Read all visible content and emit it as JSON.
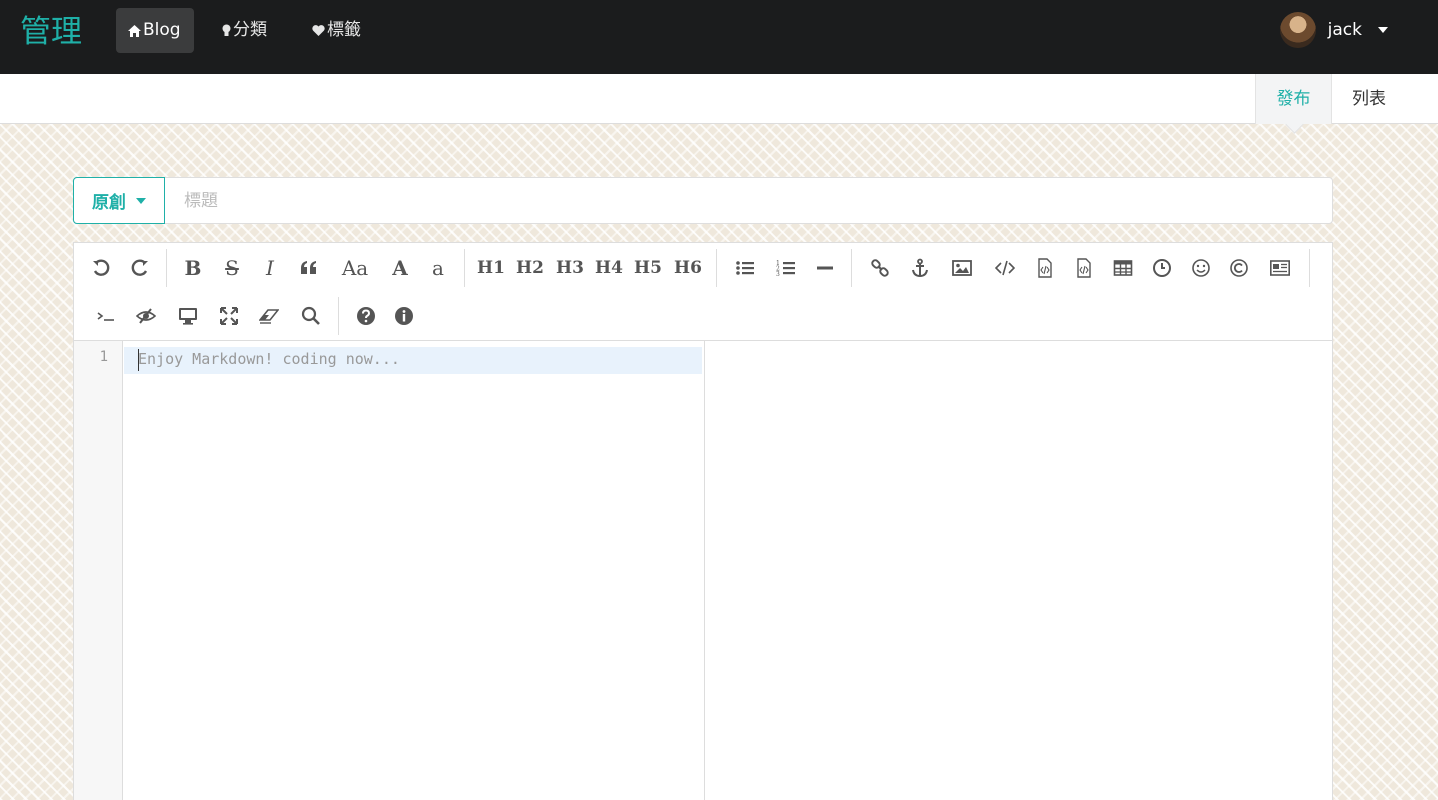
{
  "nav": {
    "brand": "管理",
    "items": [
      {
        "label": "Blog",
        "icon": "home-icon",
        "active": true
      },
      {
        "label": "分類",
        "icon": "lightbulb-icon",
        "active": false
      },
      {
        "label": "標籤",
        "icon": "heart-icon",
        "active": false
      }
    ],
    "user": {
      "name": "jack"
    }
  },
  "subnav": {
    "tabs": [
      {
        "label": "發布",
        "active": true
      },
      {
        "label": "列表",
        "active": false
      }
    ]
  },
  "post": {
    "type_label": "原創",
    "title_placeholder": "標題"
  },
  "toolbar": {
    "row1": [
      "undo",
      "redo",
      "bold",
      "strikethrough",
      "italic",
      "quote",
      "uppercase",
      "A",
      "lowercase",
      "H1",
      "H2",
      "H3",
      "H4",
      "H5",
      "H6",
      "unordered-list",
      "ordered-list",
      "hr",
      "link",
      "anchor",
      "image",
      "code",
      "code-block",
      "preformatted",
      "table",
      "datetime",
      "emoji",
      "html-entities",
      "pagebreak"
    ],
    "row2": [
      "terminal",
      "watch",
      "preview",
      "fullscreen",
      "clear",
      "search",
      "help",
      "info"
    ],
    "heading_labels": [
      "H1",
      "H2",
      "H3",
      "H4",
      "H5",
      "H6"
    ],
    "text_glyphs": {
      "bold": "B",
      "strikethrough": "S",
      "italic": "I",
      "uppercase": "Aa",
      "A": "A",
      "lowercase": "a"
    }
  },
  "editor": {
    "line_number": "1",
    "placeholder": "Enjoy Markdown! coding now..."
  }
}
